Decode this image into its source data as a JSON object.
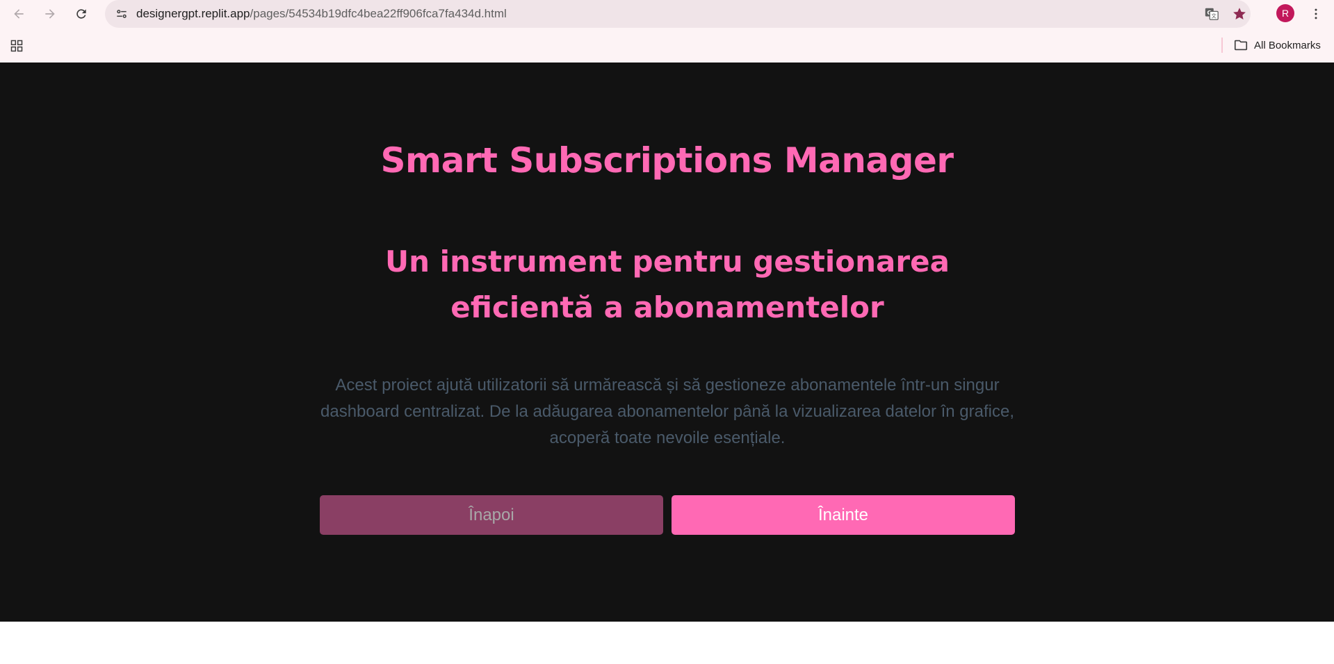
{
  "browser": {
    "url_host": "designergpt.replit.app",
    "url_path": "/pages/54534b19dfc4bea22ff906fca7fa434d.html",
    "profile_initial": "R",
    "bookmarks_label": "All Bookmarks",
    "icons": [
      "back-icon",
      "forward-icon",
      "reload-icon",
      "site-info-icon",
      "translate-icon",
      "bookmark-star-icon",
      "kebab-menu-icon",
      "apps-grid-icon",
      "folder-icon"
    ]
  },
  "page": {
    "title": "Smart Subscriptions Manager",
    "subtitle": "Un instrument pentru gestionarea eficientă a abonamentelor",
    "description": "Acest proiect ajută utilizatorii să urmărească și să gestioneze abonamentele într-un singur dashboard centralizat. De la adăugarea abonamentelor până la vizualizarea datelor în grafice, acoperă toate nevoile esențiale.",
    "back_label": "Înapoi",
    "next_label": "Înainte"
  },
  "colors": {
    "accent": "#ff69b4",
    "back_button": "#8a3f64",
    "page_background": "#121212",
    "description_text": "#4a5a6a"
  }
}
